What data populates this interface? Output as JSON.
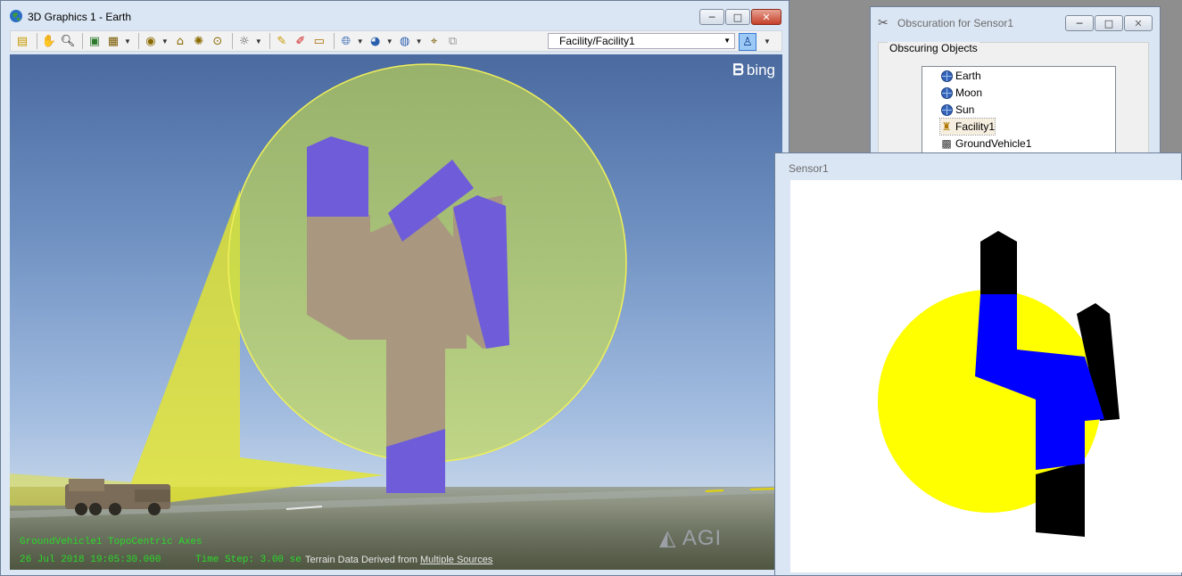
{
  "main_window": {
    "title": "3D Graphics 1 - Earth",
    "buttons": {
      "minimize": "─",
      "maximize": "□",
      "close": "✕"
    },
    "toolbar": {
      "object_selector": "Facility/Facility1",
      "icons": [
        "properties-icon",
        "pan-icon",
        "zoom-icon",
        "globe-view-icon",
        "snapshot-icon",
        "view-from-icon",
        "home-view-icon",
        "orbit-view-icon",
        "top-view-icon",
        "lighting-icon",
        "brush-icon",
        "pencil-icon",
        "measure-icon",
        "globe-icon",
        "globe-manager-icon",
        "earth-icon",
        "target-select-icon",
        "object-filter-icon",
        "sensor-view-icon"
      ]
    },
    "viewport": {
      "hud_line1": "GroundVehicle1 TopoCentric Axes",
      "hud_date": "26 Jul 2018 19:05:30.000",
      "hud_timestep": "Time Step: 3.00 se",
      "terrain_credit_prefix": "Terrain Data Derived from ",
      "terrain_credit_link": "Multiple Sources",
      "bing_logo": "bing",
      "agi_logo": "AGI"
    }
  },
  "obscuration_dialog": {
    "title": "Obscuration for Sensor1",
    "group_label": "Obscuring Objects",
    "items": [
      {
        "label": "Earth",
        "icon": "planet-icon"
      },
      {
        "label": "Moon",
        "icon": "planet-icon"
      },
      {
        "label": "Sun",
        "icon": "planet-icon"
      },
      {
        "label": "Facility1",
        "icon": "facility-icon"
      },
      {
        "label": "GroundVehicle1",
        "icon": "vehicle-icon"
      }
    ]
  },
  "sensor_window": {
    "title": "Sensor1"
  },
  "colors": {
    "sky_top": "#4a6aa0",
    "fov_circle": "#c8dd4a",
    "building": "#a9987f",
    "building_top": "#6e5cd9",
    "hud_text": "#2bd92b",
    "sensor_yellow": "#ffff00",
    "sensor_blue": "#0000ff"
  }
}
